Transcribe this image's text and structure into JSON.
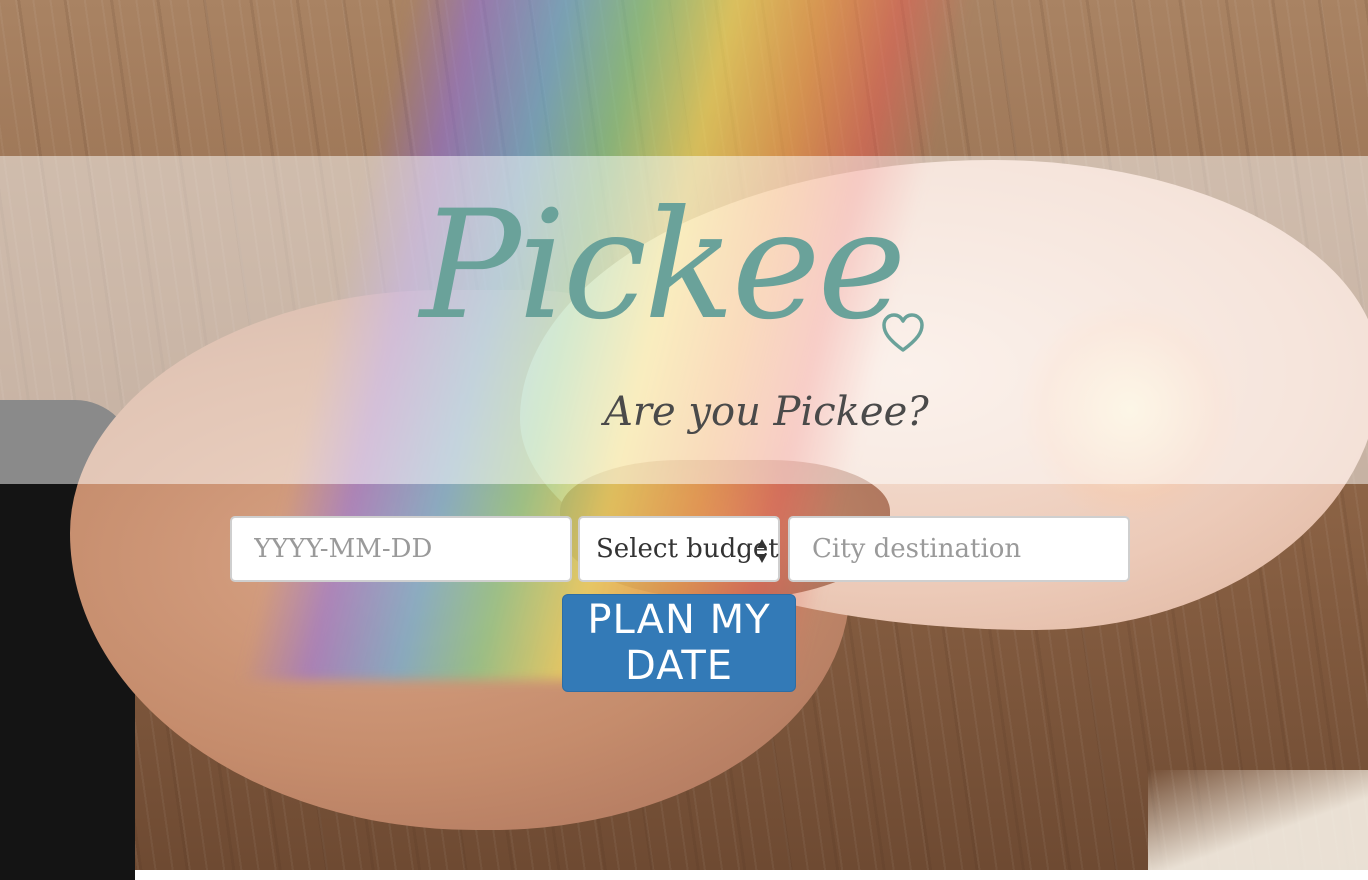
{
  "brand": {
    "logo_text": "Pickee",
    "tagline": "Are you Pickee?"
  },
  "form": {
    "date_placeholder": "YYYY-MM-DD",
    "budget_selected": "Select budget",
    "city_placeholder": "City destination",
    "submit_label": "PLAN MY DATE"
  },
  "icons": {
    "logo_heart": "heart-outline-icon",
    "budget_arrows": "up-down-arrows-icon"
  },
  "colors": {
    "logo": "#6aa29a",
    "tagline": "#4a4a4a",
    "button": "#337ab7",
    "hero_overlay": "rgba(255,255,255,0.5)"
  }
}
